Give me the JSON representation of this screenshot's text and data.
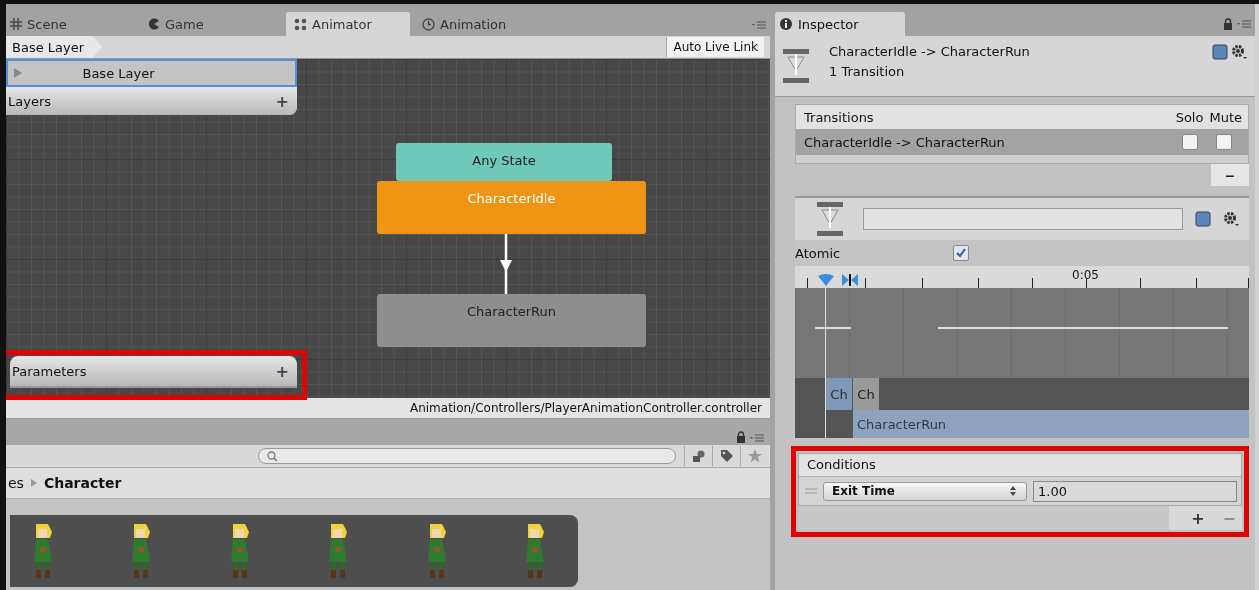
{
  "animator_window": {
    "tabs": [
      {
        "label": "Scene",
        "kind": "scene",
        "selected": false
      },
      {
        "label": "Game",
        "kind": "game",
        "selected": false
      },
      {
        "label": "Animator",
        "kind": "animator",
        "selected": true
      },
      {
        "label": "Animation",
        "kind": "animation",
        "selected": false
      }
    ],
    "breadcrumb": "Base Layer",
    "auto_live_link": "Auto Live Link",
    "layers": {
      "title": "Layers",
      "add": "+",
      "items": [
        {
          "name": "Base Layer",
          "selected": true
        }
      ]
    },
    "parameters": {
      "title": "Parameters",
      "add": "+",
      "highlighted": true
    },
    "states": [
      {
        "name": "Any State",
        "color": "#6fc9b8"
      },
      {
        "name": "CharacterIdle",
        "color": "#f09414"
      },
      {
        "name": "CharacterRun",
        "color": "#8e8e8e"
      }
    ],
    "asset_path": "Animation/Controllers/PlayerAnimationController.controller"
  },
  "project_window": {
    "breadcrumb": [
      {
        "label": "es",
        "current": false
      },
      {
        "label": "Character",
        "current": true
      }
    ]
  },
  "inspector": {
    "tab": "Inspector",
    "title": "CharacterIdle -> CharacterRun",
    "subtitle": "1 Transition",
    "transitions": {
      "header": "Transitions",
      "columns": [
        "Solo",
        "Mute"
      ],
      "rows": [
        {
          "name": "CharacterIdle -> CharacterRun",
          "selected": true,
          "solo": false,
          "mute": false
        }
      ],
      "remove": "−"
    },
    "atomic": {
      "label": "Atomic",
      "checked": true
    },
    "timeline": {
      "tick_label": "0:05",
      "clips": [
        {
          "label": "Ch",
          "kind": "source"
        },
        {
          "label": "Ch",
          "kind": "destination"
        }
      ],
      "destination_bar": "CharacterRun"
    },
    "conditions": {
      "title": "Conditions",
      "highlighted": true,
      "rows": [
        {
          "parameter": "Exit Time",
          "value": "1.00"
        }
      ],
      "add": "+",
      "remove": "−"
    }
  }
}
